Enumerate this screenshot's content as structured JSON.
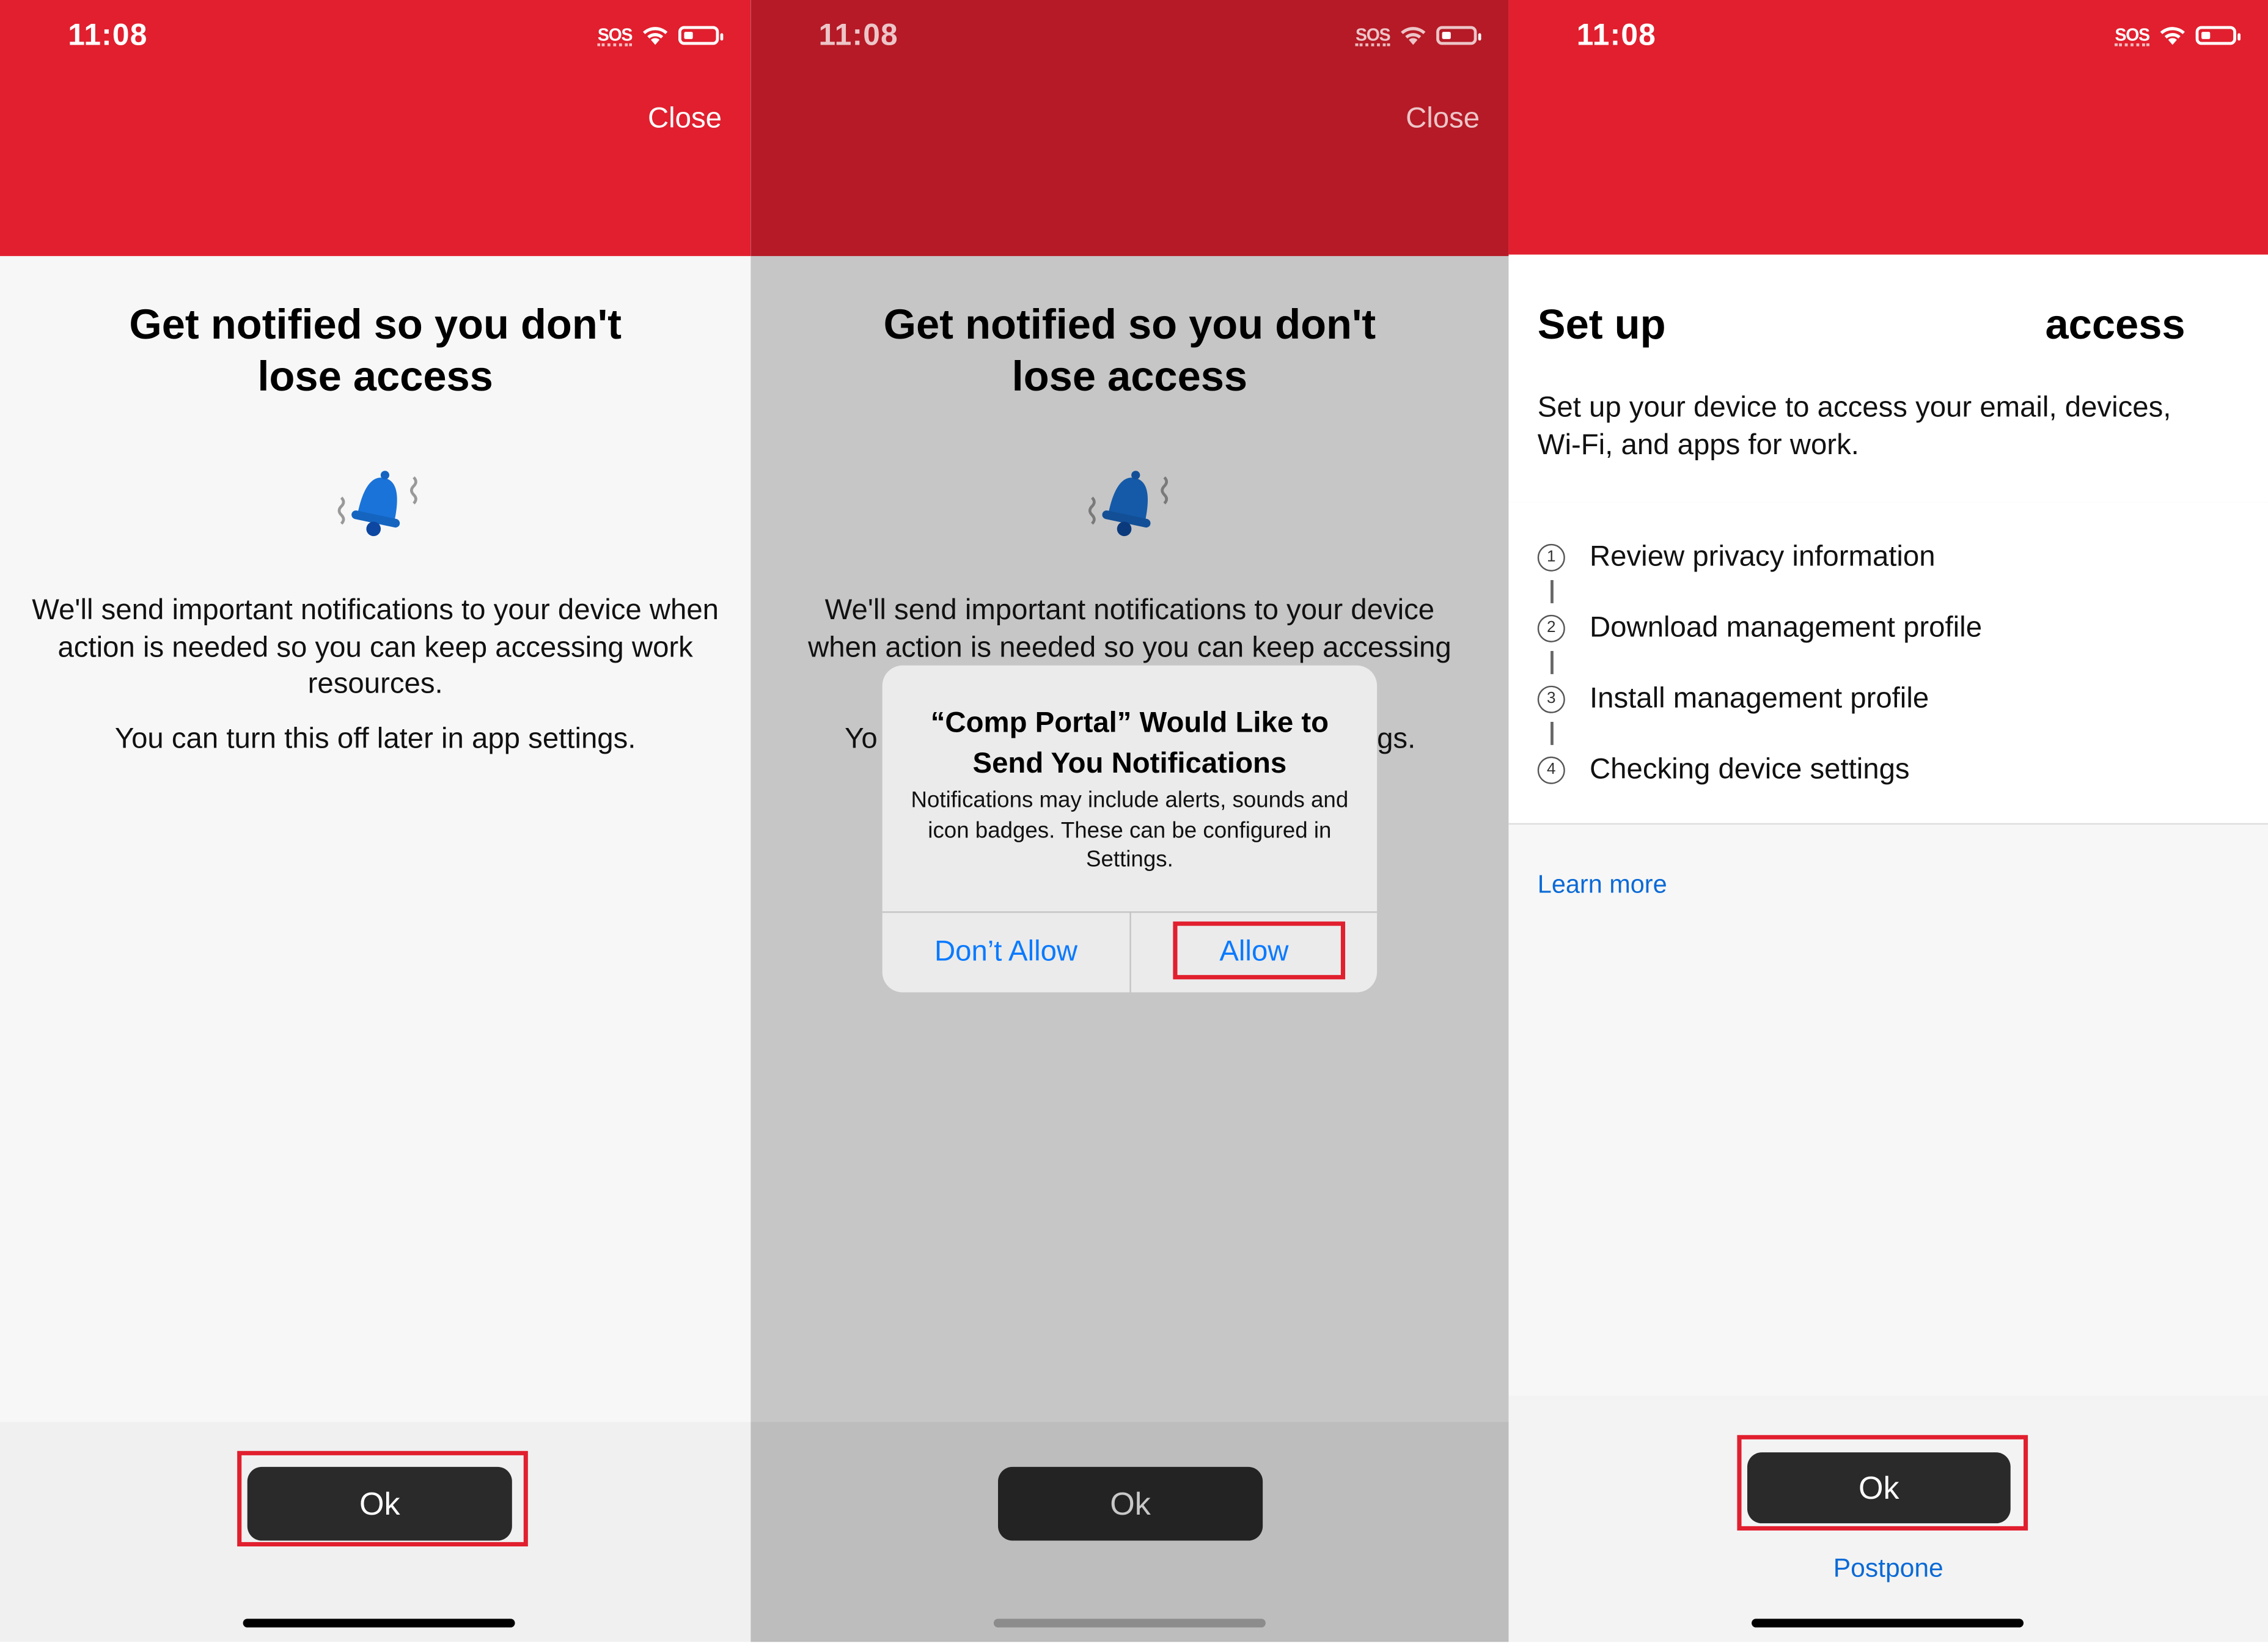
{
  "screens": [
    {
      "status_time": "11:08",
      "status_sos": "SOS",
      "close_label": "Close",
      "title_line1": "Get notified so you don't",
      "title_line2": "lose access",
      "body_para1": "We'll send important notifications to your device when action is needed so you can keep accessing work resources.",
      "body_para2": "You can turn this off later in app settings.",
      "ok_label": "Ok",
      "icon": "bell-icon"
    },
    {
      "status_time": "11:08",
      "status_sos": "SOS",
      "close_label": "Close",
      "title_line1": "Get notified so you don't",
      "title_line2": "lose access",
      "body_line1": "We'll send important notifications to your device",
      "body_line2": "when action is needed so you can keep accessing",
      "body_left_fragment": "Yo",
      "body_right_fragment": "gs.",
      "ok_label": "Ok",
      "alert": {
        "title": "“Comp Portal” Would Like to Send You Notifications",
        "message": "Notifications may include alerts, sounds and icon badges. These can be configured in Settings.",
        "deny_label": "Don’t Allow",
        "allow_label": "Allow"
      }
    },
    {
      "status_time": "11:08",
      "status_sos": "SOS",
      "title_left": "Set up",
      "title_right": "access",
      "description": "Set up your device to access your email, devices, Wi-Fi, and apps for work.",
      "steps": [
        {
          "num": "1",
          "label": "Review privacy information"
        },
        {
          "num": "2",
          "label": "Download management profile"
        },
        {
          "num": "3",
          "label": "Install management profile"
        },
        {
          "num": "4",
          "label": "Checking device settings"
        }
      ],
      "learn_more": "Learn more",
      "ok_label": "Ok",
      "postpone_label": "Postpone"
    }
  ],
  "colors": {
    "brand_red": "#e11f2e",
    "link_blue": "#0a7aff",
    "highlight_red": "#e11f2e"
  }
}
